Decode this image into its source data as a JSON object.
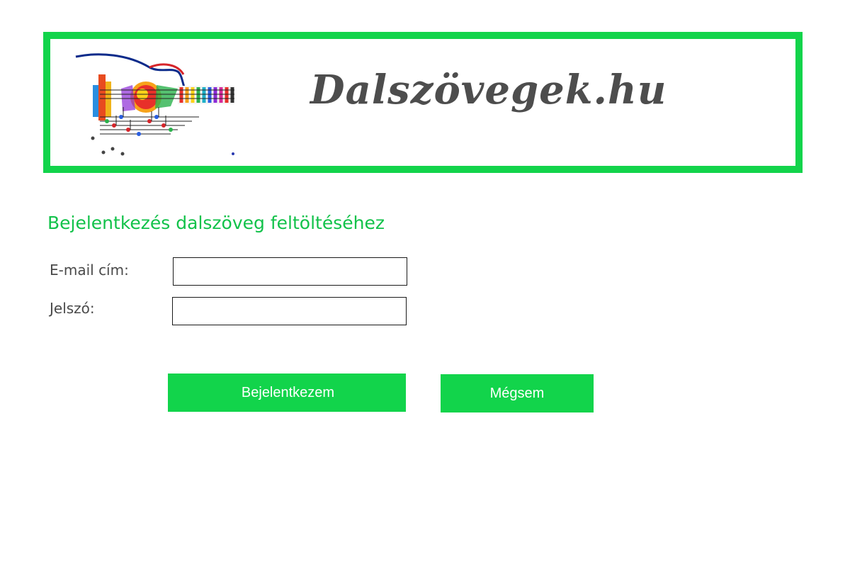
{
  "header": {
    "site_title": "Dalszövegek.hu",
    "logo_icon": "guitar-music-notes-icon",
    "border_color": "#12d44b"
  },
  "form": {
    "heading": "Bejelentkezés dalszöveg feltöltéséhez",
    "heading_color": "#12c24a",
    "email_label": "E-mail cím:",
    "email_value": "",
    "password_label": "Jelszó:",
    "password_value": "",
    "login_button": "Bejelentkezem",
    "cancel_button": "Mégsem",
    "button_color": "#12d44b"
  }
}
